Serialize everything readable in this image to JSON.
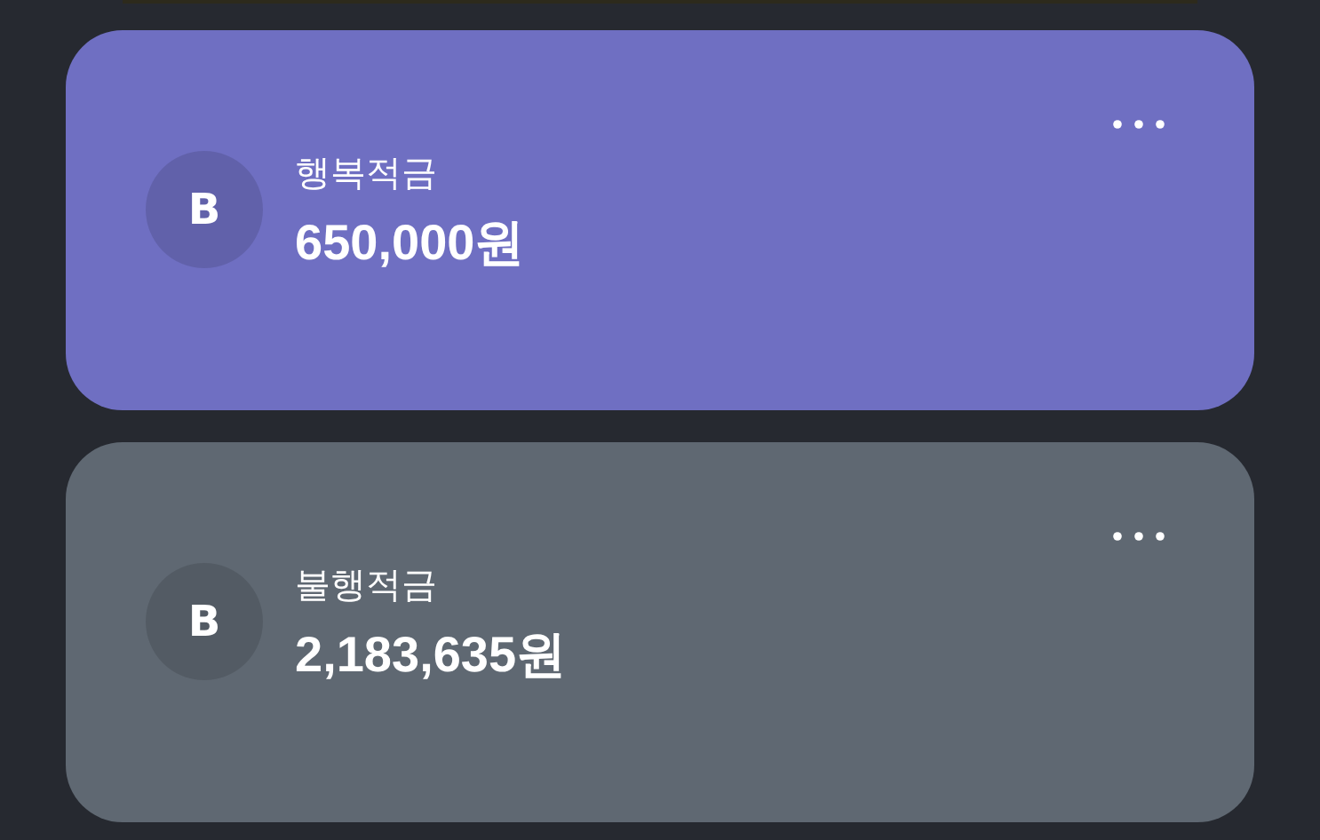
{
  "accounts": [
    {
      "name": "행복적금",
      "amount": "650,000원",
      "logo": "B",
      "color": "#6f6fc2"
    },
    {
      "name": "불행적금",
      "amount": "2,183,635원",
      "logo": "B",
      "color": "#5f6872"
    }
  ]
}
